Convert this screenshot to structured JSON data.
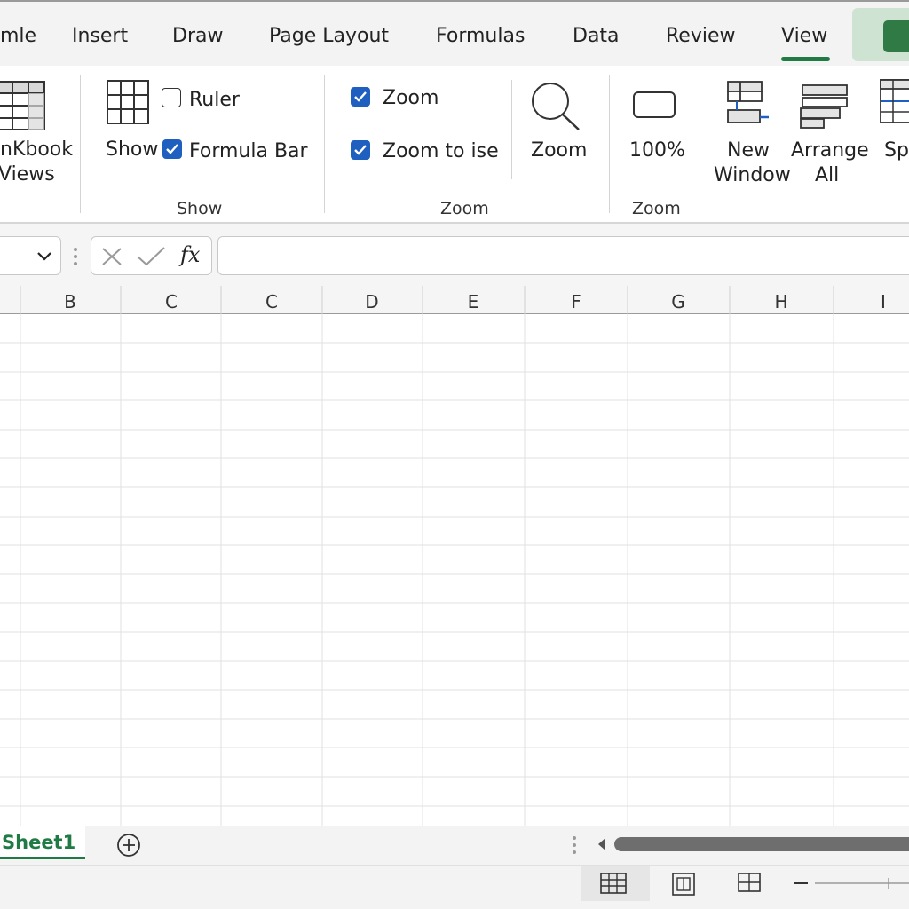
{
  "tabs": [
    "mle",
    "Insert",
    "Draw",
    "Page Layout",
    "Formulas",
    "Data",
    "Review",
    "View"
  ],
  "active_tab": "View",
  "ribbon": {
    "workbook_views": {
      "line1": "nKbook",
      "line2": "Views"
    },
    "show_group": {
      "show_label": "Show",
      "ruler_label": "Ruler",
      "ruler_checked": false,
      "formula_bar_label": "Formula Bar",
      "formula_bar_checked": true,
      "title": "Show"
    },
    "zoom_group": {
      "zoom_check_label": "Zoom",
      "zoom_check_checked": true,
      "zoom_to_sel_label": "Zoom to ise",
      "zoom_to_sel_checked": true,
      "title": "Zoom"
    },
    "zoom_button_label": "Zoom",
    "hundred_label": "100%",
    "zoom_group2_title": "Zoom",
    "new_window": {
      "line1": "New",
      "line2": "Window"
    },
    "arrange_all": {
      "line1": "Arrange",
      "line2": "All"
    },
    "split_label": "Sp"
  },
  "formula_bar": {
    "name_box_value": "",
    "fx_label": "fx",
    "formula_value": ""
  },
  "columns": [
    "B",
    "C",
    "C",
    "D",
    "E",
    "F",
    "G",
    "H",
    "I"
  ],
  "sheet_tabs": [
    "Sheet1"
  ],
  "colors": {
    "accent_green": "#1f7a44",
    "check_blue": "#1f5fbf"
  },
  "icons": [
    "table-grid-icon",
    "gridlines-icon",
    "magnifier-icon",
    "zoom-100-icon",
    "new-window-icon",
    "arrange-all-icon",
    "split-icon",
    "chevron-down-icon",
    "cancel-x-icon",
    "check-icon",
    "add-sheet-icon",
    "normal-view-icon",
    "page-layout-view-icon",
    "page-break-view-icon"
  ]
}
